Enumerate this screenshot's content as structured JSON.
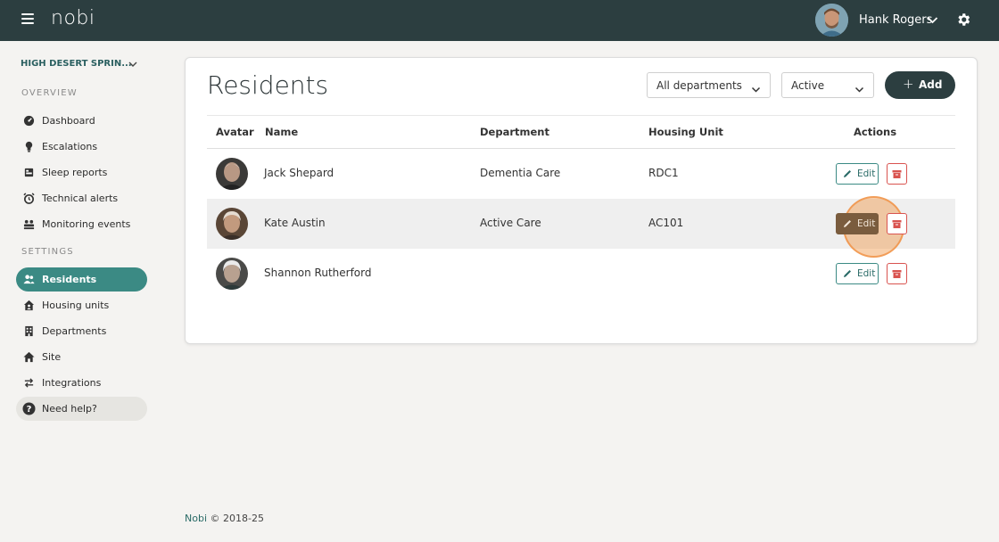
{
  "topbar": {
    "logo": "nobi",
    "user_name": "Hank Rogers"
  },
  "sidebar": {
    "site_name": "HIGH DESERT SPRIN...",
    "overview_label": "OVERVIEW",
    "settings_label": "SETTINGS",
    "overview_items": [
      {
        "label": "Dashboard",
        "icon": "dashboard-icon"
      },
      {
        "label": "Escalations",
        "icon": "bulb-icon"
      },
      {
        "label": "Sleep reports",
        "icon": "bed-icon"
      },
      {
        "label": "Technical alerts",
        "icon": "alarm-clock-icon"
      },
      {
        "label": "Monitoring events",
        "icon": "people-monitor-icon"
      }
    ],
    "settings_items": [
      {
        "label": "Residents",
        "icon": "users-icon",
        "active": true
      },
      {
        "label": "Housing units",
        "icon": "house-user-icon"
      },
      {
        "label": "Departments",
        "icon": "building-icon"
      },
      {
        "label": "Site",
        "icon": "home-icon"
      },
      {
        "label": "Integrations",
        "icon": "arrows-exchange-icon"
      }
    ],
    "help_label": "Need help?"
  },
  "main": {
    "title": "Residents",
    "department_filter": "All departments",
    "status_filter": "Active",
    "add_label": "Add",
    "columns": [
      "Avatar",
      "Name",
      "Department",
      "Housing Unit",
      "Actions"
    ],
    "edit_label": "Edit",
    "rows": [
      {
        "name": "Jack Shepard",
        "department": "Dementia Care",
        "housing_unit": "RDC1"
      },
      {
        "name": "Kate Austin",
        "department": "Active Care",
        "housing_unit": "AC101"
      },
      {
        "name": "Shannon Rutherford",
        "department": "",
        "housing_unit": ""
      }
    ]
  },
  "footer": {
    "brand": "Nobi",
    "copyright": "© 2018-25"
  },
  "colors": {
    "topbar": "#2c3e40",
    "accent": "#3b8a84",
    "delete": "#d9534f",
    "background": "#f4f3f1"
  }
}
